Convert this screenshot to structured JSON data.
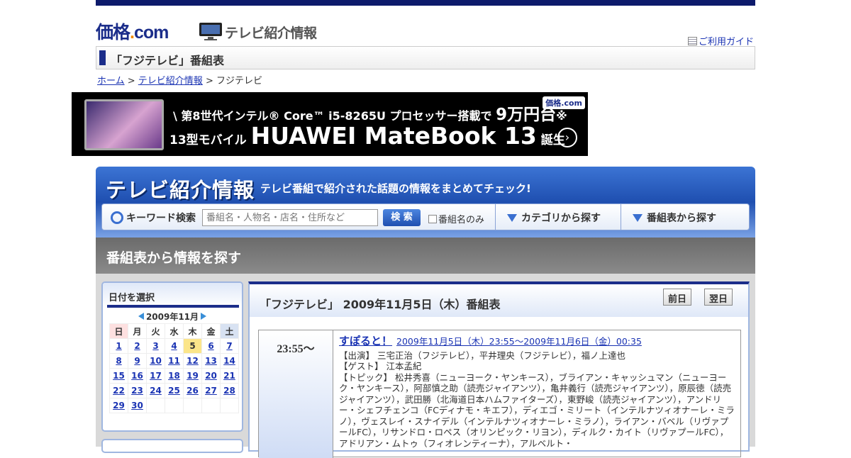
{
  "header": {
    "logo_main": "価格",
    "logo_dot": ".",
    "logo_com": "com",
    "section_title": "テレビ紹介情報",
    "guide_link": "ご利用ガイド"
  },
  "page_title": "「フジテレビ」番組表",
  "breadcrumb": {
    "home": "ホーム",
    "sep1": " > ",
    "section": "テレビ紹介情報",
    "sep2": " > ",
    "current": "フジテレビ"
  },
  "ad": {
    "line1_a": "\\  第8世代インテル® Core™ i5-8265U プロセッサー搭載で ",
    "line1_b": "9万円台",
    "line1_c": "※",
    "line2_a": "13型モバイル ",
    "line2_b": "HUAWEI MateBook 13",
    "line2_c": " 誕生",
    "badge": "価格.com",
    "arrow": "›"
  },
  "tv_header": {
    "big_title": "テレビ紹介情報",
    "subtitle": "テレビ番組で紹介された話題の情報をまとめてチェック!",
    "keyword_label": "キーワード検索",
    "search_placeholder": "番組名・人物名・店名・住所など",
    "search_button": "検 索",
    "checkbox_label": "番組名のみ",
    "nav_category": "カテゴリから探す",
    "nav_schedule": "番組表から探す"
  },
  "section_heading": "番組表から情報を探す",
  "calendar": {
    "title": "日付を選択",
    "month": "2009年11月",
    "weekdays": [
      "日",
      "月",
      "火",
      "水",
      "木",
      "金",
      "土"
    ],
    "weeks": [
      [
        "1",
        "2",
        "3",
        "4",
        "5",
        "6",
        "7"
      ],
      [
        "8",
        "9",
        "10",
        "11",
        "12",
        "13",
        "14"
      ],
      [
        "15",
        "16",
        "17",
        "18",
        "19",
        "20",
        "21"
      ],
      [
        "22",
        "23",
        "24",
        "25",
        "26",
        "27",
        "28"
      ],
      [
        "29",
        "30",
        "",
        "",
        "",
        "",
        ""
      ]
    ],
    "today": "5"
  },
  "schedule": {
    "title": "「フジテレビ」 2009年11月5日（木）番組表",
    "prev_button": "前日",
    "next_button": "翌日",
    "program": {
      "time": "23:55～",
      "name": "すぽると！",
      "datetime": "2009年11月5日（木）23:55～2009年11月6日（金）00:35",
      "cast": "【出演】 三宅正治（フジテレビ），平井理央（フジテレビ），福ノ上達也",
      "guest": "【ゲスト】 江本孟紀",
      "topic": "【トピック】 松井秀喜（ニューヨーク・ヤンキース），ブライアン・キャッシュマン（ニューヨーク・ヤンキース），阿部慎之助（読売ジャイアンツ），亀井義行（読売ジャイアンツ），原辰徳（読売ジャイアンツ），武田勝（北海道日本ハムファイターズ），東野峻（読売ジャイアンツ），アンドリー・シェフチェンコ（FCディナモ・キエフ），ディエゴ・ミリート（インテルナツィオナーレ・ミラノ），ヴェスレイ・スナイデル（インテルナツィオナーレ・ミラノ），ライアン・バベル（リヴァプールFC），リサンドロ・ロペス（オリンピック・リヨン），ディルク・カイト（リヴァプールFC），アドリアン・ムトゥ（フィオレンティーナ），アルベルト・"
    }
  }
}
